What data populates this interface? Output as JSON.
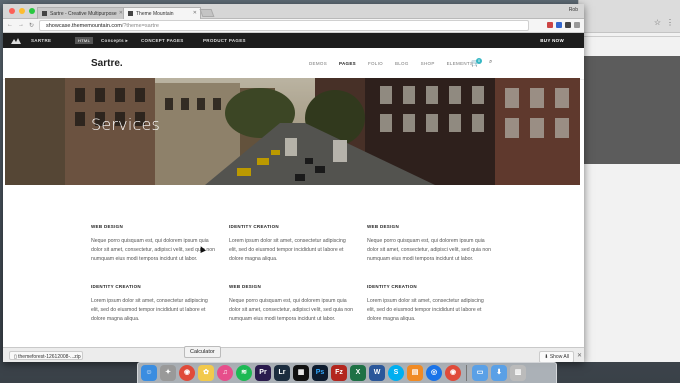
{
  "browser": {
    "tabs": [
      {
        "title": "Sartre - Creative Multipurpose",
        "active": false
      },
      {
        "title": "Theme Mountain",
        "active": true
      }
    ],
    "user_name": "Rob",
    "url_host": "showcase.thememountain.com",
    "url_path": "/?theme=sartre"
  },
  "site": {
    "topbar": {
      "items": [
        "SARTRE",
        "HTML",
        "Concepts ▸",
        "CONCEPT PAGES",
        "PRODUCT PAGES"
      ],
      "buy_label": "BUY NOW"
    },
    "brand": "Sartre.",
    "menu": [
      "DEMOS",
      "PAGES",
      "FOLIO",
      "BLOG",
      "SHOP",
      "ELEMENTS"
    ],
    "active_menu": "PAGES",
    "cart_count": "0",
    "hero_title": "Services",
    "services": [
      {
        "title": "WEB DESIGN",
        "text": "Neque porro quisquam est, qui dolorem ipsum quia dolor sit amet, consectetur, adipisci velit, sed quia non numquam eius modi tempora incidunt ut labor."
      },
      {
        "title": "IDENTITY CREATION",
        "text": "Lorem ipsum dolor sit amet, consectetur adipiscing elit, sed do eiusmod tempor incididunt ut labore et dolore magna aliqua."
      },
      {
        "title": "WEB DESIGN",
        "text": "Neque porro quisquam est, qui dolorem ipsum quia dolor sit amet, consectetur, adipisci velit, sed quia non numquam eius modi tempora incidunt ut labor."
      },
      {
        "title": "IDENTITY CREATION",
        "text": "Lorem ipsum dolor sit amet, consectetur adipiscing elit, sed do eiusmod tempor incididunt ut labore et dolore magna aliqua."
      },
      {
        "title": "WEB DESIGN",
        "text": "Neque porro quisquam est, qui dolorem ipsum quia dolor sit amet, consectetur, adipisci velit, sed quia non numquam eius modi tempora incidunt ut labor."
      },
      {
        "title": "IDENTITY CREATION",
        "text": "Lorem ipsum dolor sit amet, consectetur adipiscing elit, sed do eiusmod tempor incididunt ut labore et dolore magna aliqua."
      }
    ]
  },
  "downloads": {
    "file": "themeforest-12612008-...zip",
    "show_all": "Show All"
  },
  "dock_tooltip": "Calculator",
  "dock_apps": [
    "finder",
    "launchpad",
    "chrome",
    "photos",
    "itunes",
    "spotify",
    "premiere",
    "photoshop-lightroom",
    "lightroom",
    "final-cut",
    "photoshop",
    "filezilla",
    "excel",
    "word",
    "skype",
    "ibooks",
    "safari-like",
    "chrome-2"
  ],
  "colors": {
    "accent": "#35b7c4",
    "topbar": "#1d1d1d"
  }
}
